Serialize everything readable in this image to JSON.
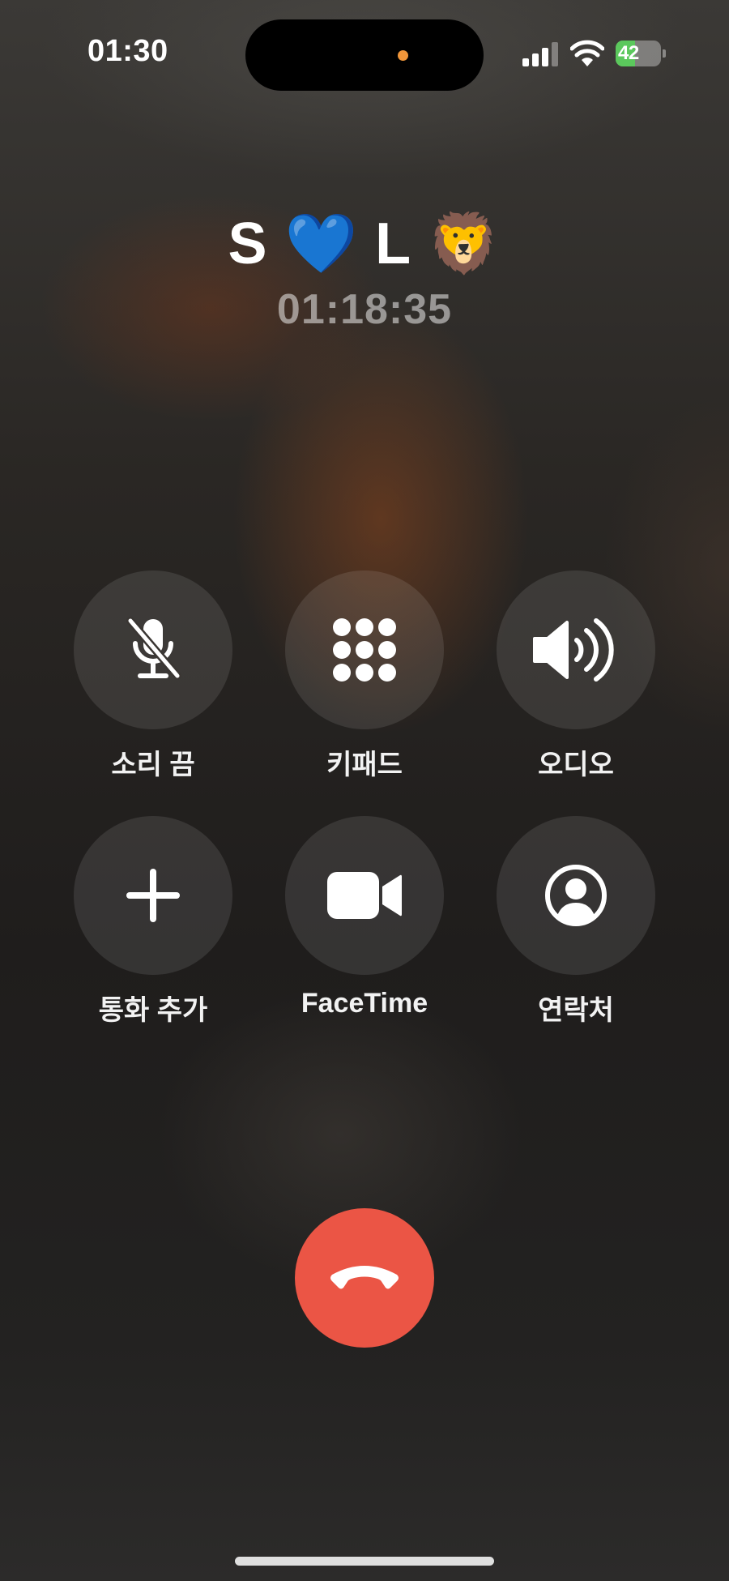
{
  "status_bar": {
    "time": "01:30",
    "battery_level": "42",
    "battery_fraction": 0.42,
    "battery_color": "#5bc85c",
    "signal_icon": "cellular-signal-icon",
    "wifi_icon": "wifi-icon",
    "privacy_indicator_color": "#f0963a"
  },
  "call": {
    "caller_name": "S 💙 L 🦁",
    "duration": "01:18:35"
  },
  "controls": {
    "mute": {
      "label": "소리 끔",
      "icon": "microphone-slash-icon"
    },
    "keypad": {
      "label": "키패드",
      "icon": "keypad-icon"
    },
    "audio": {
      "label": "오디오",
      "icon": "speaker-icon"
    },
    "add_call": {
      "label": "통화 추가",
      "icon": "plus-icon"
    },
    "facetime": {
      "label": "FaceTime",
      "icon": "video-camera-icon"
    },
    "contacts": {
      "label": "연락처",
      "icon": "person-circle-icon"
    }
  },
  "end_call": {
    "icon": "phone-hangup-icon",
    "color": "#eb5545"
  }
}
